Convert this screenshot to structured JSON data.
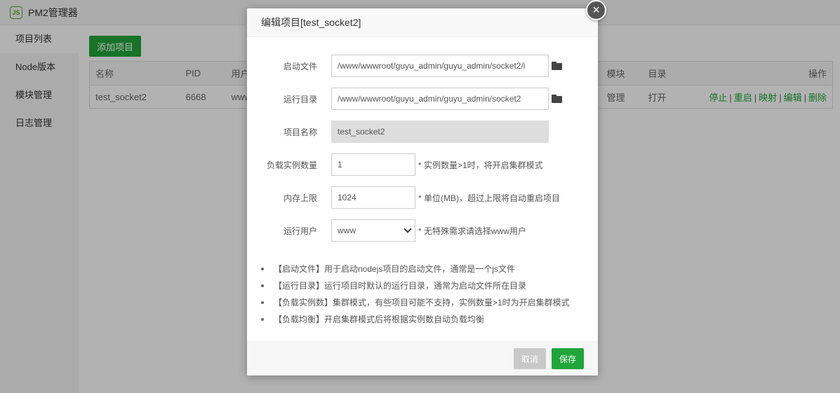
{
  "app": {
    "title": "PM2管理器",
    "logo_text": "JS"
  },
  "sidebar": {
    "items": [
      {
        "label": "项目列表",
        "active": true
      },
      {
        "label": "Node版本",
        "active": false
      },
      {
        "label": "模块管理",
        "active": false
      },
      {
        "label": "日志管理",
        "active": false
      }
    ]
  },
  "main": {
    "add_button": "添加项目",
    "table": {
      "headers": [
        "名称",
        "PID",
        "用户",
        "模块",
        "目录",
        "操作"
      ],
      "row": {
        "name": "test_socket2",
        "pid": "6668",
        "user": "www",
        "module": "管理",
        "dir": "打开",
        "ops": [
          "停止",
          "重启",
          "映射",
          "编辑",
          "删除"
        ]
      }
    }
  },
  "modal": {
    "title": "编辑项目[test_socket2]",
    "close_symbol": "×",
    "fields": {
      "start_file": {
        "label": "启动文件",
        "value": "/www/wwwroot/guyu_admin/guyu_admin/socket2/i"
      },
      "run_dir": {
        "label": "运行目录",
        "value": "/www/wwwroot/guyu_admin/guyu_admin/socket2"
      },
      "project_name": {
        "label": "项目名称",
        "value": "test_socket2"
      },
      "instances": {
        "label": "负载实例数量",
        "value": "1",
        "hint": "* 实例数量>1时，将开启集群模式"
      },
      "memory": {
        "label": "内存上限",
        "value": "1024",
        "hint": "* 单位(MB)，超过上限将自动重启项目"
      },
      "run_user": {
        "label": "运行用户",
        "value": "www",
        "hint": "* 无特殊需求请选择www用户"
      }
    },
    "notes": [
      "【启动文件】用于启动nodejs项目的启动文件，通常是一个js文件",
      "【运行目录】运行项目时默认的运行目录，通常为启动文件所在目录",
      "【负载实例数】集群模式，有些项目可能不支持，实例数量>1时为开启集群模式",
      "【负载均衡】开启集群模式后将根据实例数自动负载均衡"
    ],
    "cancel_label": "取消",
    "save_label": "保存"
  },
  "colors": {
    "accent": "#20a53a",
    "overlay": "rgba(0,0,0,0.3)"
  }
}
